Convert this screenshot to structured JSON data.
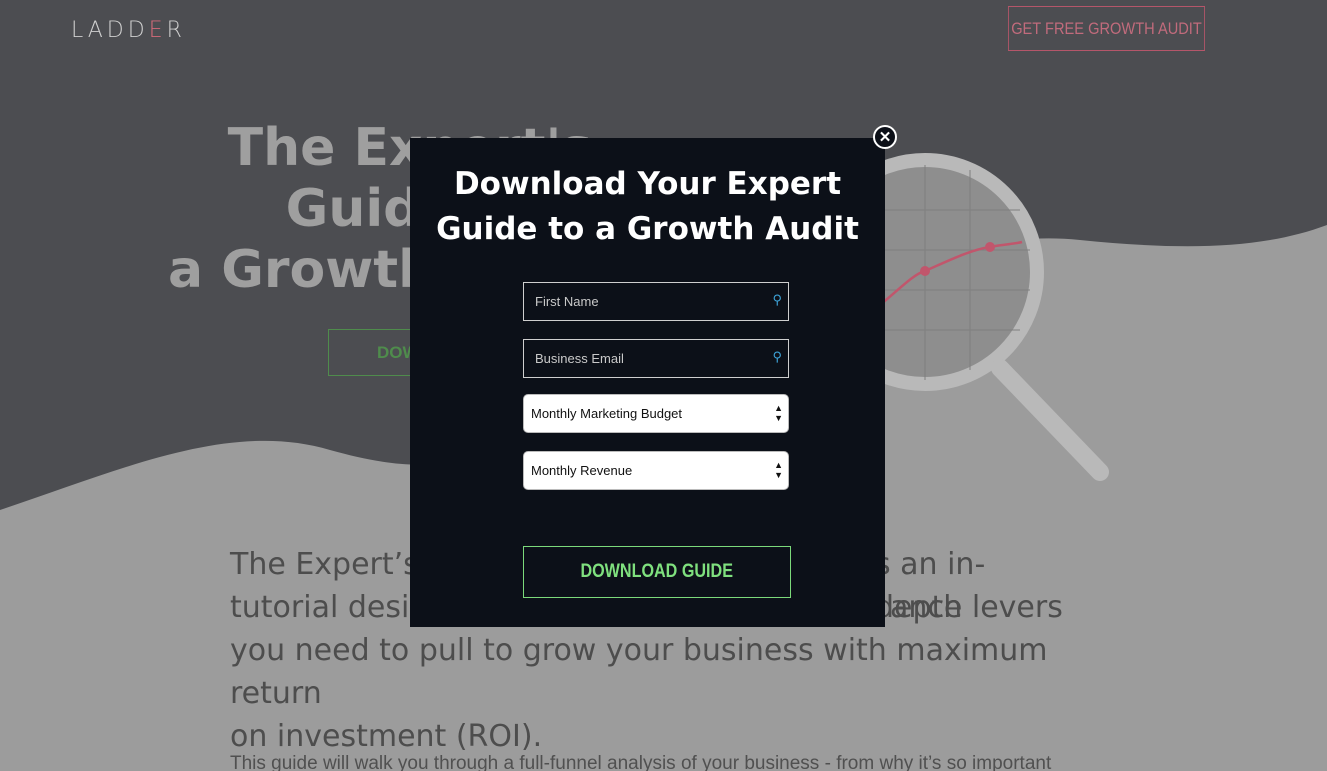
{
  "header": {
    "logo_text": "LADD",
    "logo_e": "E",
    "logo_end": "R",
    "cta_label": "GET FREE GROWTH AUDIT"
  },
  "hero": {
    "title_line1": "The Expert's Guide to",
    "title_line2": "a Growth M",
    "button_label": "DOW"
  },
  "body": {
    "paragraph": "The Expert’s Guide to a Growth Audit is an in-depth tutorial designed to help you identify the performance levers you need to pull to grow your business with maximum return on investment (ROI).",
    "paragraph_visible": [
      "The Expert’s G",
      "tutorial desig",
      "you need to pull to grow your business with maximum return",
      "on investment (ROI)."
    ],
    "right_fragments": [
      "s an in-depth",
      "ance levers"
    ],
    "small_text": "This guide will walk you through a full-funnel analysis of your business - from why it’s so important"
  },
  "modal": {
    "title_line1": "Download Your Expert",
    "title_line2": "Guide to a Growth Audit",
    "first_name_placeholder": "First Name",
    "email_placeholder": "Business Email",
    "budget_select": "Monthly Marketing Budget",
    "revenue_select": "Monthly Revenue",
    "submit_label": "DOWNLOAD GUIDE",
    "close_icon": "close-icon"
  },
  "colors": {
    "modal_bg": "#0c1018",
    "accent_green": "#7fe07e",
    "accent_pink": "#c16b7c"
  }
}
